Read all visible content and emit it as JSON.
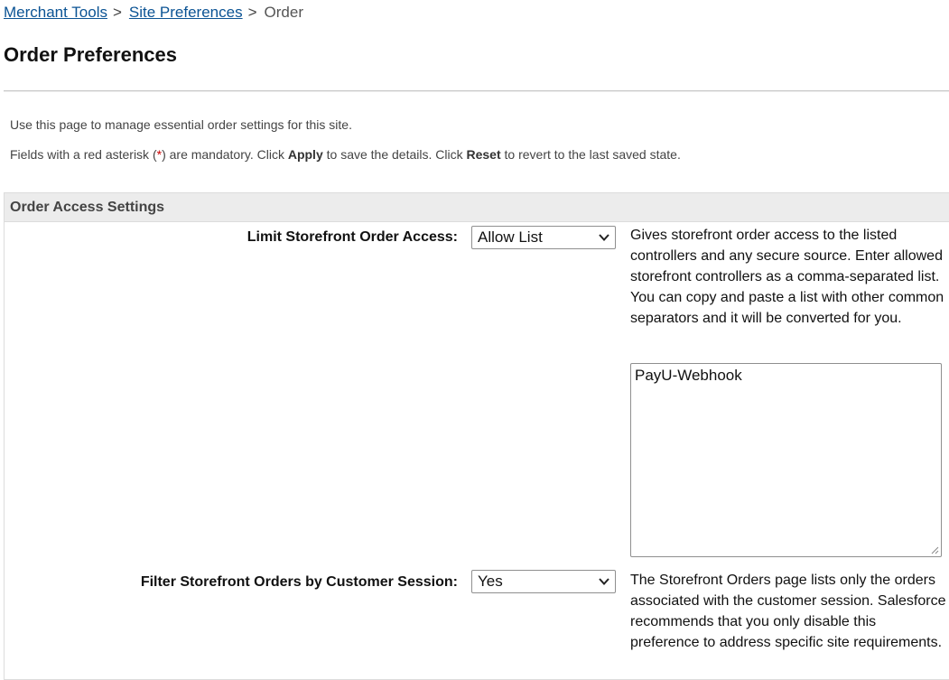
{
  "breadcrumb": {
    "items": [
      {
        "label": "Merchant Tools"
      },
      {
        "label": "Site Preferences"
      }
    ],
    "separator": ">",
    "current": "Order"
  },
  "page": {
    "title": "Order Preferences",
    "intro": "Use this page to manage essential order settings for this site.",
    "instructions": {
      "part1": "Fields with a red asterisk (",
      "asterisk": "*",
      "part2": ") are mandatory. Click ",
      "apply": "Apply",
      "part3": " to save the details. Click ",
      "reset": "Reset",
      "part4": " to revert to the last saved state."
    }
  },
  "section": {
    "title": "Order Access Settings",
    "fields": [
      {
        "label": "Limit Storefront Order Access:",
        "selected": "Allow List",
        "help": "Gives storefront order access to the listed controllers and any secure source. Enter allowed storefront controllers as a comma-separated list. You can copy and paste a list with other common separators and it will be converted for you.",
        "textarea_value": "PayU-Webhook"
      },
      {
        "label": "Filter Storefront Orders by Customer Session:",
        "selected": "Yes",
        "help": "The Storefront Orders page lists only the orders associated with the customer session. Salesforce recommends that you only disable this preference to address specific site requirements."
      }
    ]
  },
  "colors": {
    "link": "#0b5394",
    "section_header_bg": "#ececec",
    "required": "#cc0000"
  },
  "icons": {
    "select_arrow": "chevron-down-icon",
    "resize_handle": "resize-grip-icon"
  }
}
